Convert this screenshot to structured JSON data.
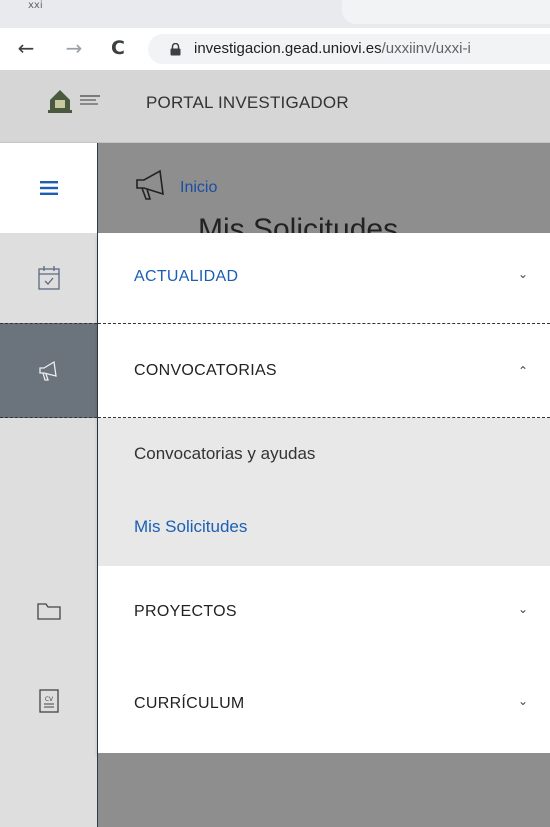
{
  "browser": {
    "tab_fragment": "xxi",
    "url_host": "investigacion.gead.uniovi.es",
    "url_path": "/uxxiinv/uxxi-i",
    "back_glyph": "←",
    "forward_glyph": "→",
    "reload_glyph": "C"
  },
  "header": {
    "portal_title": "PORTAL INVESTIGADOR"
  },
  "breadcrumb": {
    "home": "Inicio"
  },
  "page": {
    "title": "Mis Solicitudes"
  },
  "sidebar": {
    "menu_icon": "hamburger-icon",
    "items": [
      {
        "icon": "calendar-check-icon"
      },
      {
        "icon": "megaphone-icon",
        "active": true
      },
      {
        "icon": "folder-icon"
      },
      {
        "icon": "cv-document-icon"
      }
    ]
  },
  "menu": {
    "items": [
      {
        "label": "ACTUALIDAD",
        "chevron": "⌄",
        "highlighted": true
      },
      {
        "label": "CONVOCATORIAS",
        "chevron": "⌃",
        "expanded": true
      },
      {
        "label": "PROYECTOS",
        "chevron": "⌄"
      },
      {
        "label": "CURRÍCULUM",
        "chevron": "⌄"
      }
    ],
    "subitems": [
      {
        "label": "Convocatorias y ayudas"
      },
      {
        "label": "Mis Solicitudes",
        "active": true
      }
    ]
  },
  "colors": {
    "link_blue": "#1a5fb4",
    "active_rail": "#6b737c"
  }
}
